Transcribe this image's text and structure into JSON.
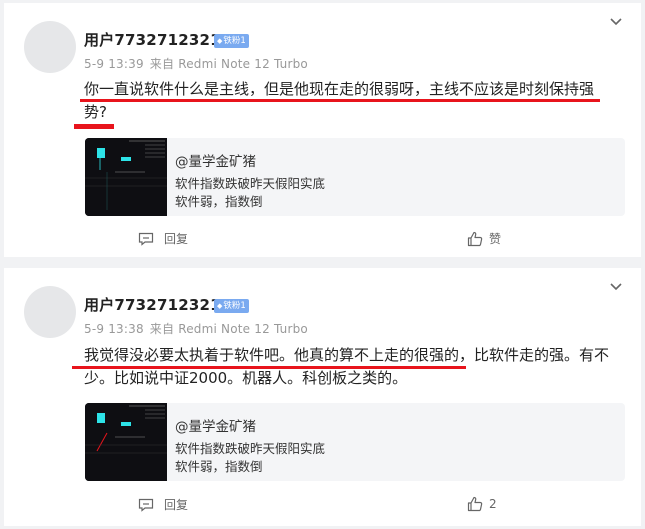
{
  "comments": [
    {
      "username": "用户7732712321",
      "badge": "铁粉1",
      "date": "5-9 13:39",
      "source": "来自 Redmi Note 12 Turbo",
      "text": "你一直说软件什么是主线，但是他现在走的很弱呀，主线不应该是时刻保持强势?",
      "quote": {
        "author": "@量学金矿猪",
        "line1": "软件指数跌破昨天假阳实底",
        "line2": "软件弱，指数倒"
      },
      "reply_label": "回复",
      "like_label": "赞"
    },
    {
      "username": "用户7732712321",
      "badge": "铁粉1",
      "date": "5-9 13:38",
      "source": "来自 Redmi Note 12 Turbo",
      "text": "我觉得没必要太执着于软件吧。他真的算不上走的很强的，比软件走的强。有不少。比如说中证2000。机器人。科创板之类的。",
      "quote": {
        "author": "@量学金矿猪",
        "line1": "软件指数跌破昨天假阳实底",
        "line2": "软件弱，指数倒"
      },
      "reply_label": "回复",
      "like_label": "2"
    }
  ],
  "colors": {
    "highlight": "#e8141c",
    "badge": "#7aaaf0",
    "meta": "#999999"
  },
  "icons": [
    "chevron-down-icon",
    "reply-icon",
    "thumbs-up-icon",
    "badge-icon"
  ]
}
